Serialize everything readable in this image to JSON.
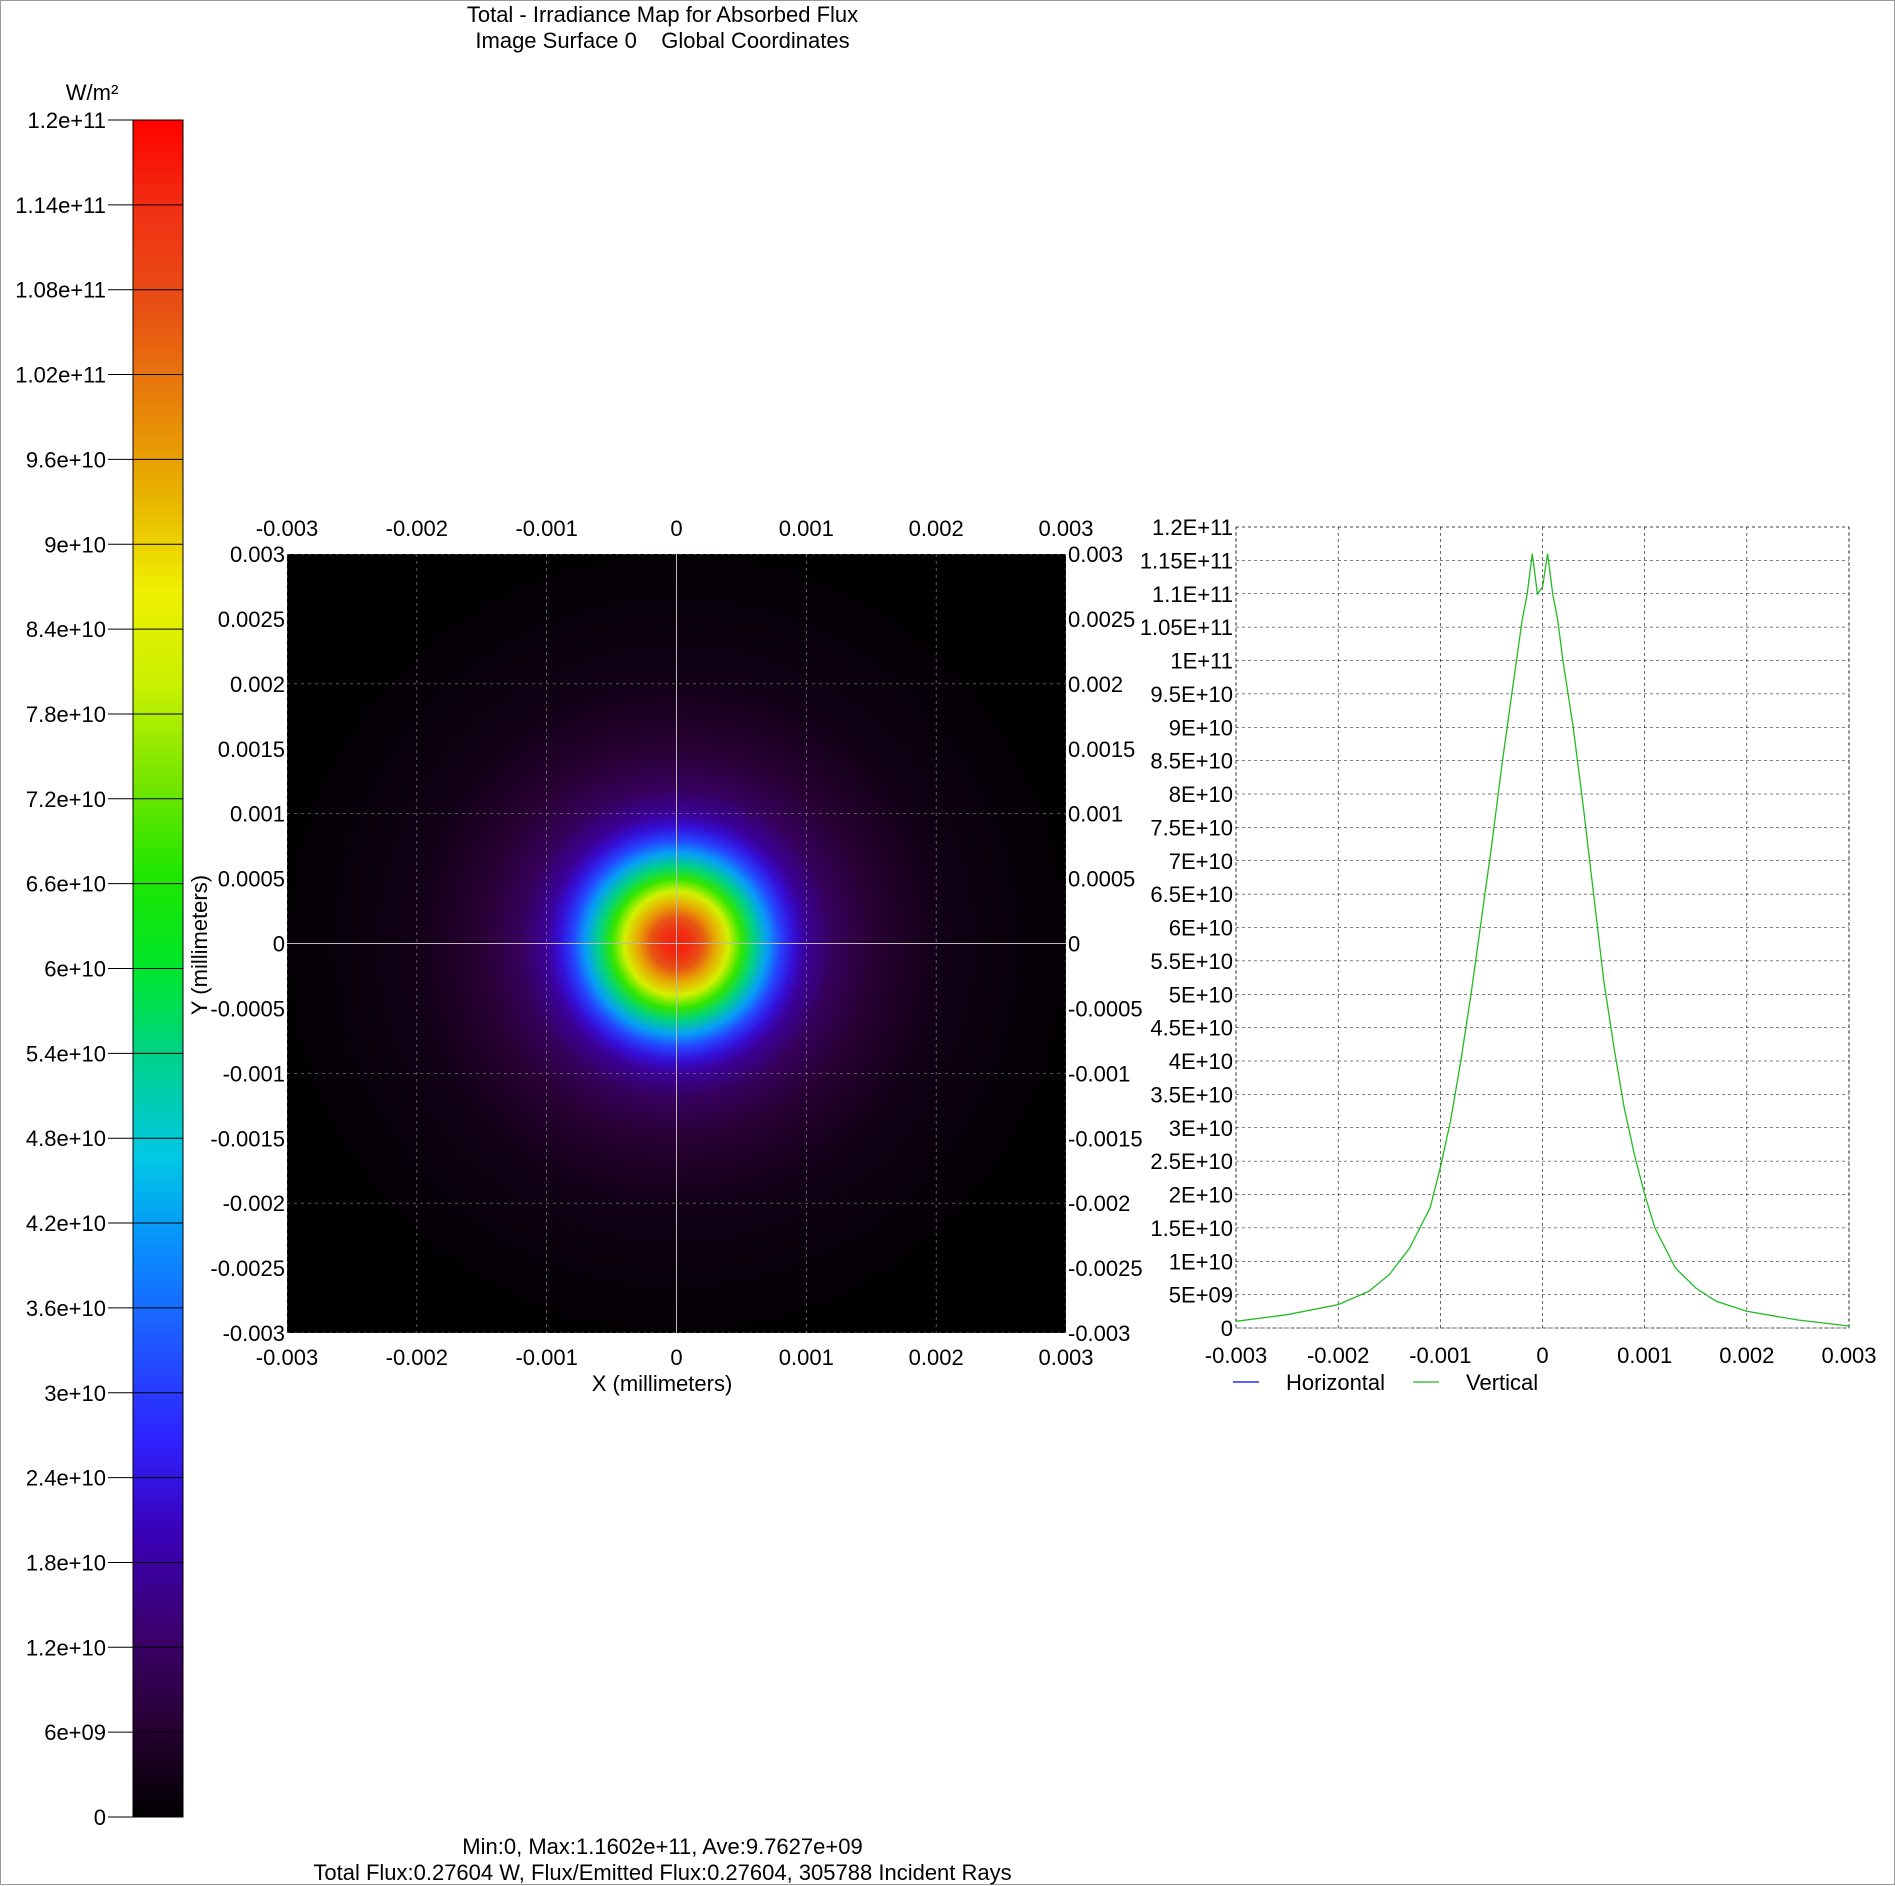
{
  "title": {
    "line1": "Total - Irradiance Map for Absorbed Flux",
    "line2": "Image Surface 0    Global Coordinates"
  },
  "footer": {
    "line1": "Min:0, Max:1.1602e+11, Ave:9.7627e+09",
    "line2": "Total Flux:0.27604 W, Flux/Emitted Flux:0.27604, 305788 Incident Rays"
  },
  "colorbar": {
    "unit": "W/m²",
    "range": [
      0,
      120000000000
    ],
    "ticks": [
      "0",
      "6e+09",
      "1.2e+10",
      "1.8e+10",
      "2.4e+10",
      "3e+10",
      "3.6e+10",
      "4.2e+10",
      "4.8e+10",
      "5.4e+10",
      "6e+10",
      "6.6e+10",
      "7.2e+10",
      "7.8e+10",
      "8.4e+10",
      "9e+10",
      "9.6e+10",
      "1.02e+11",
      "1.08e+11",
      "1.14e+11",
      "1.2e+11"
    ],
    "colors": [
      "#000000",
      "#2a0035",
      "#3c0070",
      "#3a00b8",
      "#2f22ff",
      "#1f55ff",
      "#0a8cff",
      "#00c8e6",
      "#00d090",
      "#00e62a",
      "#1fe600",
      "#78e600",
      "#c8f000",
      "#f0f000",
      "#e8b400",
      "#e8820a",
      "#e85014",
      "#f03214",
      "#ff0000"
    ]
  },
  "chart_data": [
    {
      "type": "heatmap",
      "xlabel": "X (millimeters)",
      "ylabel": "Y (millimeters)",
      "xlim": [
        -0.003,
        0.003
      ],
      "ylim": [
        -0.003,
        0.003
      ],
      "x_ticks": [
        "-0.003",
        "-0.002",
        "-0.001",
        "0",
        "0.001",
        "0.002",
        "0.003"
      ],
      "y_ticks": [
        "0.003",
        "0.0025",
        "0.002",
        "0.0015",
        "0.001",
        "0.0005",
        "0",
        "-0.0005",
        "-0.001",
        "-0.0015",
        "-0.002",
        "-0.0025",
        "-0.003"
      ],
      "grid": true,
      "peak_value": 116020000000,
      "radial_profile": {
        "r": [
          0,
          0.0001,
          0.0002,
          0.0003,
          0.0004,
          0.0005,
          0.0006,
          0.0007,
          0.0008,
          0.0009,
          0.001,
          0.0012,
          0.0015,
          0.002,
          0.0025,
          0.003
        ],
        "value": [
          116000000000,
          114000000000,
          106000000000,
          95000000000,
          82000000000,
          68000000000,
          54000000000,
          42000000000,
          31000000000,
          23000000000,
          17000000000,
          11000000000,
          6500000000,
          3000000000,
          1500000000,
          500000000
        ]
      }
    },
    {
      "type": "line",
      "xlim": [
        -0.003,
        0.003
      ],
      "ylim": [
        0,
        120000000000
      ],
      "x_ticks": [
        "-0.003",
        "-0.002",
        "-0.001",
        "0",
        "0.001",
        "0.002",
        "0.003"
      ],
      "y_ticks": [
        "0",
        "5E+09",
        "1E+10",
        "1.5E+10",
        "2E+10",
        "2.5E+10",
        "3E+10",
        "3.5E+10",
        "4E+10",
        "4.5E+10",
        "5E+10",
        "5.5E+10",
        "6E+10",
        "6.5E+10",
        "7E+10",
        "7.5E+10",
        "8E+10",
        "8.5E+10",
        "9E+10",
        "9.5E+10",
        "1E+11",
        "1.05E+11",
        "1.1E+11",
        "1.15E+11",
        "1.2E+11"
      ],
      "grid": true,
      "legend": "bottom",
      "series": [
        {
          "name": "Horizontal",
          "color": "#0000ff",
          "x": [],
          "y": []
        },
        {
          "name": "Vertical",
          "color": "#22bb22",
          "x": [
            -0.003,
            -0.0025,
            -0.002,
            -0.0017,
            -0.0015,
            -0.0013,
            -0.0011,
            -0.001,
            -0.0009,
            -0.0008,
            -0.0007,
            -0.0006,
            -0.0005,
            -0.0004,
            -0.0003,
            -0.0002,
            -0.00015,
            -0.0001,
            -5e-05,
            0,
            5e-05,
            0.0001,
            0.00015,
            0.0002,
            0.0003,
            0.0004,
            0.0005,
            0.0006,
            0.0007,
            0.0008,
            0.0009,
            0.001,
            0.0011,
            0.0013,
            0.0015,
            0.0017,
            0.002,
            0.0025,
            0.003
          ],
          "y": [
            1000000000,
            2000000000,
            3500000000,
            5500000000,
            8000000000,
            12000000000,
            18000000000,
            24000000000,
            31000000000,
            40000000000,
            50000000000,
            61000000000,
            72000000000,
            84000000000,
            95000000000,
            106000000000,
            110000000000,
            116000000000,
            110000000000,
            111000000000,
            116000000000,
            110000000000,
            106000000000,
            100000000000,
            90000000000,
            78000000000,
            65000000000,
            52000000000,
            42000000000,
            33000000000,
            26000000000,
            20000000000,
            15000000000,
            9000000000,
            6000000000,
            4000000000,
            2500000000,
            1200000000,
            300000000
          ]
        }
      ]
    }
  ]
}
